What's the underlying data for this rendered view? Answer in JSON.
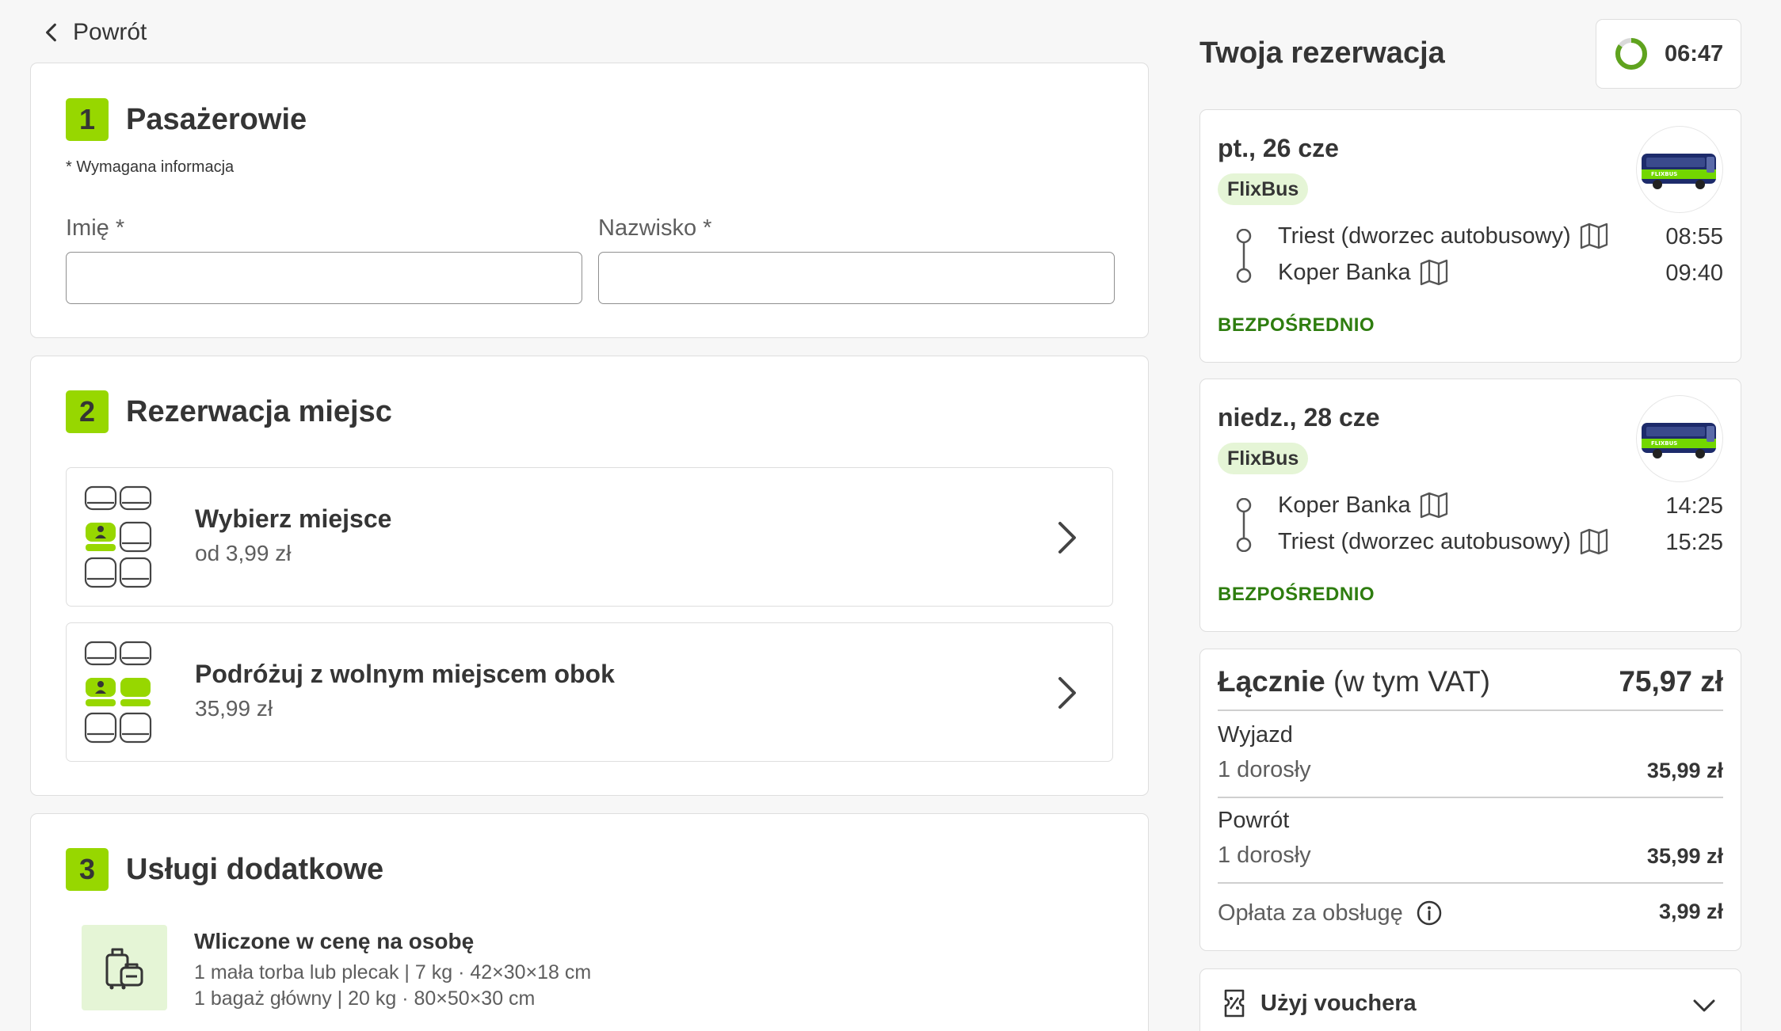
{
  "nav": {
    "back_label": "Powrót"
  },
  "passengers": {
    "step": "1",
    "title": "Pasażerowie",
    "required_note": "* Wymagana informacja",
    "first_name_label": "Imię *",
    "last_name_label": "Nazwisko *",
    "first_name_value": "",
    "last_name_value": ""
  },
  "seats": {
    "step": "2",
    "title": "Rezerwacja miejsc",
    "options": [
      {
        "title": "Wybierz miejsce",
        "price": "od 3,99 zł"
      },
      {
        "title": "Podróżuj z wolnym miejscem obok",
        "price": "35,99 zł"
      }
    ]
  },
  "services": {
    "step": "3",
    "title": "Usługi dodatkowe",
    "included_title": "Wliczone w cenę na osobę",
    "included_lines": [
      "1 mała torba lub plecak | 7 kg · 42×30×18 cm",
      "1 bagaż główny | 20 kg · 80×50×30 cm"
    ]
  },
  "summary": {
    "title": "Twoja rezerwacja",
    "timer": "06:47",
    "timer_remaining_fraction": 0.85,
    "trips": [
      {
        "date": "pt., 26 cze",
        "brand": "FlixBus",
        "from": "Triest (dworzec autobusowy)",
        "from_time": "08:55",
        "to": "Koper Banka",
        "to_time": "09:40",
        "type": "BEZPOŚREDNIO"
      },
      {
        "date": "niedz., 28 cze",
        "brand": "FlixBus",
        "from": "Koper Banka",
        "from_time": "14:25",
        "to": "Triest (dworzec autobusowy)",
        "to_time": "15:25",
        "type": "BEZPOŚREDNIO"
      }
    ],
    "total": {
      "label_bold": "Łącznie",
      "label_rest": " (w tym VAT)",
      "value": "75,97 zł",
      "outbound_label": "Wyjazd",
      "outbound_sub": "1 dorosły",
      "outbound_price": "35,99 zł",
      "return_label": "Powrót",
      "return_sub": "1 dorosły",
      "return_price": "35,99 zł",
      "fee_label": "Opłata za obsługę",
      "fee_price": "3,99 zł"
    },
    "voucher_label": "Użyj vouchera"
  },
  "colors": {
    "accent_green": "#97d700",
    "light_green": "#e5f5d6",
    "direct_green": "#2e7d0f",
    "text": "#353535"
  }
}
